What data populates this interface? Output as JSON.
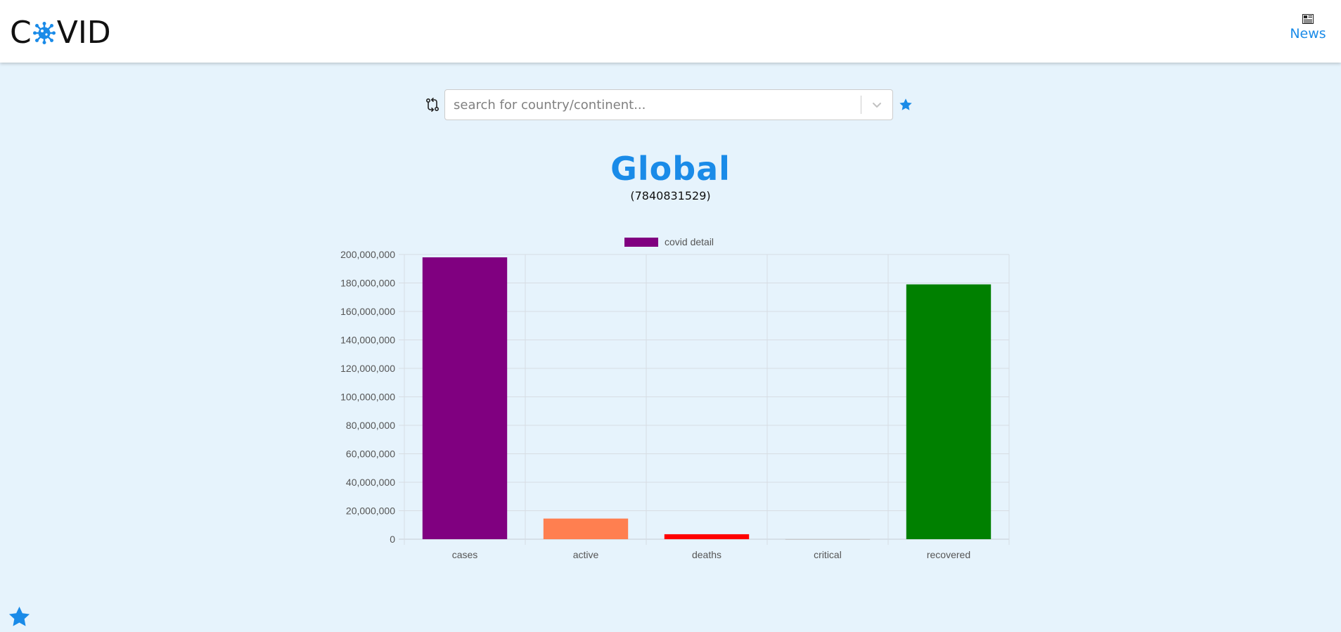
{
  "header": {
    "logo_prefix": "C",
    "logo_suffix": "VID",
    "logo_icon": "virus-icon",
    "nav_news_label": "News",
    "nav_news_icon": "newspaper-icon"
  },
  "search": {
    "placeholder": "search for country/continent...",
    "swap_icon": "compare-arrows-icon",
    "dropdown_icon": "chevron-down-icon",
    "star_icon": "star-icon"
  },
  "region": {
    "name": "Global",
    "population": "(7840831529)"
  },
  "colors": {
    "accent": "#1a8be8",
    "background": "#e6f3fc",
    "cases": "#800080",
    "active": "#ff7f50",
    "deaths": "#ff0000",
    "critical": "#c0c0c0",
    "recovered": "#008000"
  },
  "footer": {
    "favorite_icon": "star-icon"
  },
  "chart_data": {
    "type": "bar",
    "legend": [
      "covid detail"
    ],
    "legend_placement": "top-center",
    "categories": [
      "cases",
      "active",
      "deaths",
      "critical"
    ],
    "categories_extra": [
      "recovered"
    ],
    "series": [
      {
        "name": "covid detail",
        "values": [
          198000000,
          14500000,
          3500000,
          100000,
          179000000
        ],
        "colors": [
          "#800080",
          "#ff7f50",
          "#ff0000",
          "#c0c0c0",
          "#008000"
        ]
      }
    ],
    "all_categories": [
      "cases",
      "active",
      "deaths",
      "critical",
      "recovered"
    ],
    "ylim": [
      0,
      200000000
    ],
    "yticks": [
      "200,000,000",
      "180,000,000",
      "160,000,000",
      "140,000,000",
      "120,000,000",
      "100,000,000",
      "80,000,000",
      "60,000,000",
      "40,000,000",
      "20,000,000",
      "0"
    ],
    "ytick_values": [
      200000000,
      180000000,
      160000000,
      140000000,
      120000000,
      100000000,
      80000000,
      60000000,
      40000000,
      20000000,
      0
    ],
    "grid": true
  }
}
